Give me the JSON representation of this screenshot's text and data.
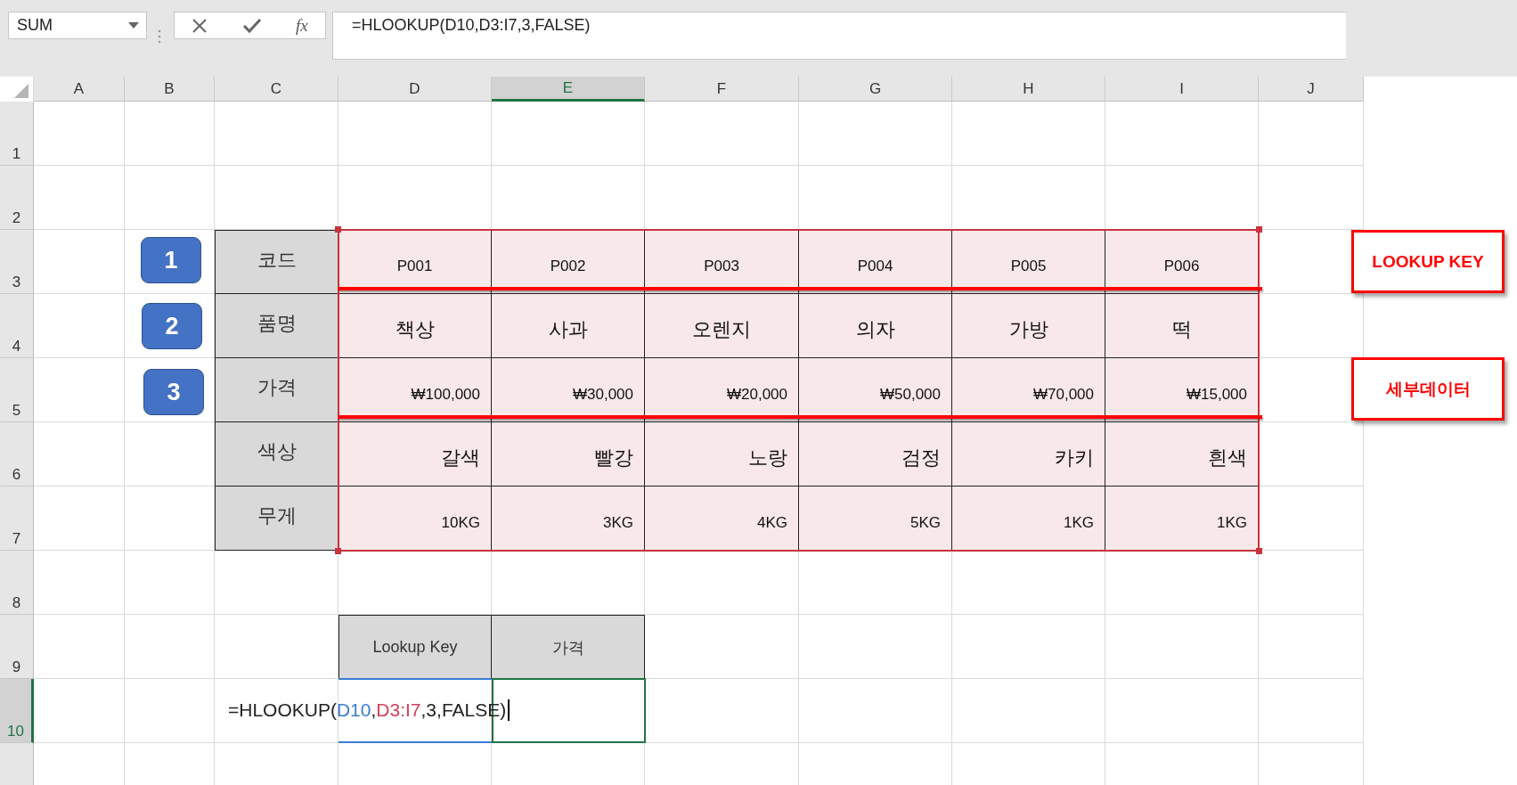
{
  "name_box": {
    "value": "SUM"
  },
  "formula_bar": {
    "function_label": "fx",
    "formula": "=HLOOKUP(D10,D3:I7,3,FALSE)"
  },
  "columns": [
    {
      "label": "A",
      "selected": false
    },
    {
      "label": "B",
      "selected": false
    },
    {
      "label": "C",
      "selected": false
    },
    {
      "label": "D",
      "selected": false
    },
    {
      "label": "E",
      "selected": true
    },
    {
      "label": "F",
      "selected": false
    },
    {
      "label": "G",
      "selected": false
    },
    {
      "label": "H",
      "selected": false
    },
    {
      "label": "I",
      "selected": false
    },
    {
      "label": "J",
      "selected": false
    }
  ],
  "rows": [
    {
      "label": "1",
      "selected": false
    },
    {
      "label": "2",
      "selected": false
    },
    {
      "label": "3",
      "selected": false
    },
    {
      "label": "4",
      "selected": false
    },
    {
      "label": "5",
      "selected": false
    },
    {
      "label": "6",
      "selected": false
    },
    {
      "label": "7",
      "selected": false
    },
    {
      "label": "8",
      "selected": false
    },
    {
      "label": "9",
      "selected": false
    },
    {
      "label": "10",
      "selected": true
    }
  ],
  "fields": [
    {
      "label": "코드",
      "values": [
        "P001",
        "P002",
        "P003",
        "P004",
        "P005",
        "P006"
      ]
    },
    {
      "label": "품명",
      "values": [
        "책상",
        "사과",
        "오렌지",
        "의자",
        "가방",
        "떡"
      ]
    },
    {
      "label": "가격",
      "values": [
        "₩100,000",
        "₩30,000",
        "₩20,000",
        "₩50,000",
        "₩70,000",
        "₩15,000"
      ]
    },
    {
      "label": "색상",
      "values": [
        "갈색",
        "빨강",
        "노랑",
        "검정",
        "카키",
        "흰색"
      ]
    },
    {
      "label": "무게",
      "values": [
        "10KG",
        "3KG",
        "4KG",
        "5KG",
        "1KG",
        "1KG"
      ]
    }
  ],
  "badges": [
    "1",
    "2",
    "3"
  ],
  "callouts": [
    "LOOKUP KEY",
    "세부데이터"
  ],
  "lookup_table": {
    "headers": [
      "Lookup Key",
      "가격"
    ]
  },
  "cell_edit": [
    {
      "text": "=HLOOKUP("
    },
    {
      "text": "D10",
      "color": "#3d7bd6"
    },
    {
      "text": ","
    },
    {
      "text": "D3:I7",
      "color": "#d1425a"
    },
    {
      "text": ",3,FALSE)"
    }
  ]
}
